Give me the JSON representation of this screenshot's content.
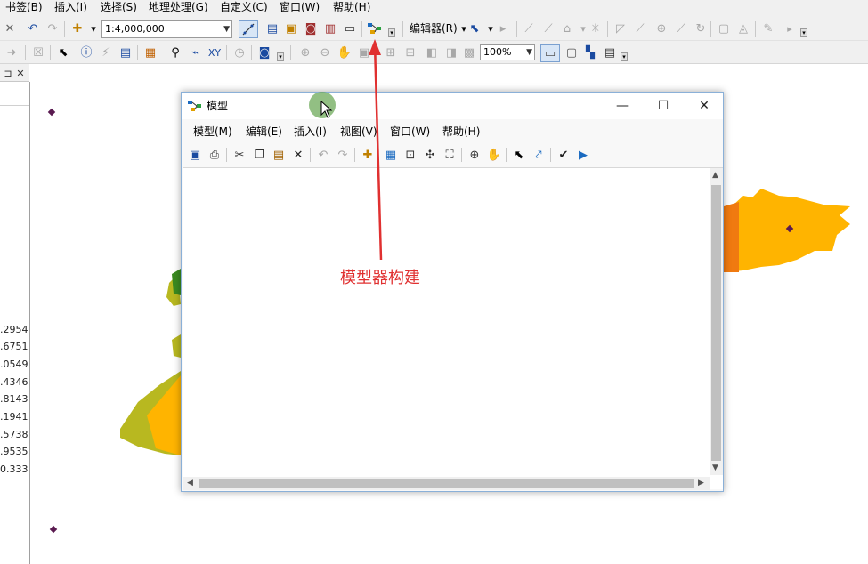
{
  "menubar": {
    "items": [
      "书签(B)",
      "插入(I)",
      "选择(S)",
      "地理处理(G)",
      "自定义(C)",
      "窗口(W)",
      "帮助(H)"
    ]
  },
  "toolbar": {
    "scale_value": "1:4,000,000",
    "zoom_value": "100%",
    "editor_label": "编辑器(R)"
  },
  "toc": {
    "values": [
      ".2954",
      ".6751",
      ".0549",
      ".4346",
      ".8143",
      ".1941",
      ".5738",
      ".9535",
      "0.333"
    ]
  },
  "model_window": {
    "title": "模型",
    "menu": [
      "模型(M)",
      "编辑(E)",
      "插入(I)",
      "视图(V)",
      "窗口(W)",
      "帮助(H)"
    ],
    "controls": {
      "minimize": "—",
      "maximize": "☐",
      "close": "✕"
    }
  },
  "annotation": {
    "text": "模型器构建",
    "color": "#e03030"
  },
  "colors": {
    "orange": "#ffb400",
    "dark_orange": "#f07a10",
    "olive": "#b8b820",
    "green": "#3a8a20",
    "accent": "#0a60c0"
  }
}
